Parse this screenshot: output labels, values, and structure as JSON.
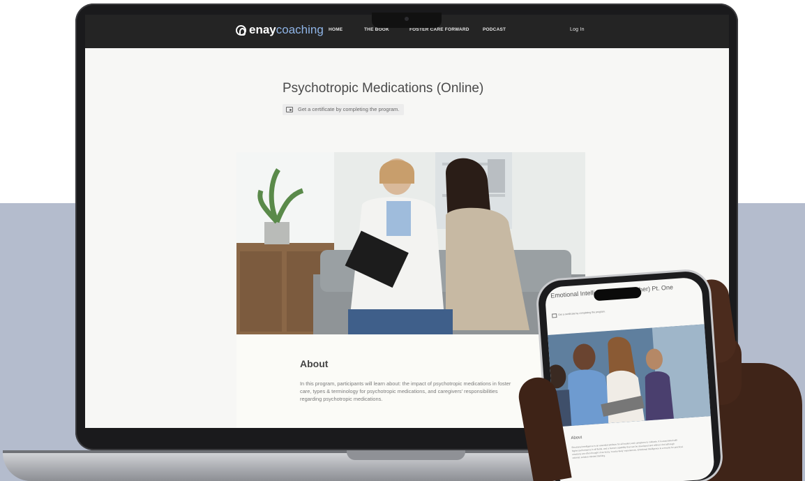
{
  "site": {
    "brand_a": "enay",
    "brand_b": "coaching",
    "nav": [
      "HOME",
      "THE BOOK",
      "FOSTER CARE FORWARD",
      "PODCAST"
    ],
    "login": "Log In"
  },
  "course": {
    "title": "Psychotropic Medications (Online)",
    "certificate_note": "Get a certificate by completing the program.",
    "about_heading": "About",
    "about_text": "In this program, participants will learn about: the impact of psychotropic medications in foster care, types & terminology for psychotropic medications, and caregivers' responsibilities regarding psychotropic medications."
  },
  "phone": {
    "title": "Emotional Intelli... anced Refresher) Pt. One",
    "certificate_note": "Get a certificate by completing the program.",
    "about_heading": "About",
    "about_text": "Emotional Intelligence is an essential attribute for all leaders and caregivers to cultivate. It is associated with higher performance in all fields, and a human capability that can be developed and refined. And although emotions are often thought of as fuzzy, 'touchy-feely' experiences, Emotional Intelligence is a means for practical, rational, solution-minded thinking."
  },
  "colors": {
    "nav_bg": "#242424",
    "brand_accent": "#8fb4e6",
    "band": "#b4bccd"
  }
}
